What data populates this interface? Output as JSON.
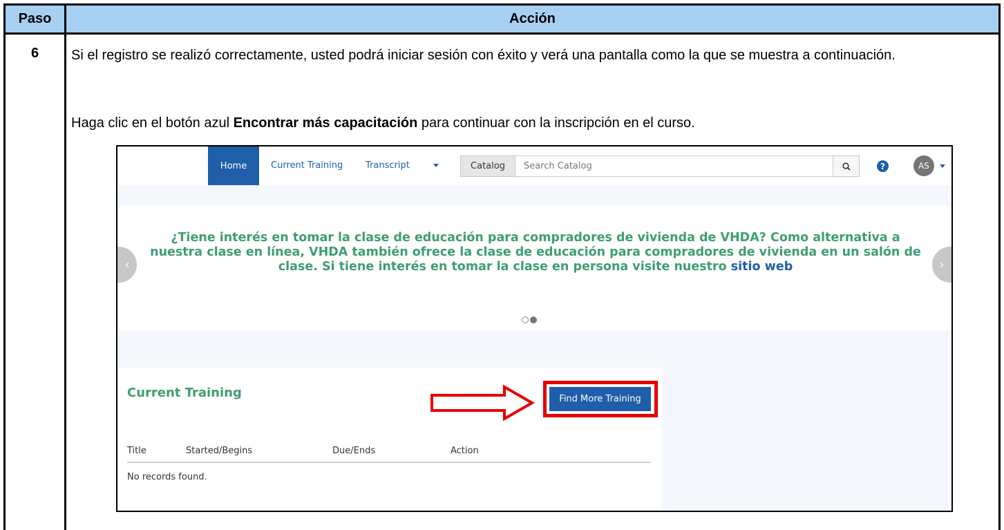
{
  "table": {
    "header_step": "Paso",
    "header_action": "Acción",
    "step_number": "6",
    "paragraph1": "Si el registro se realizó correctamente, usted podrá iniciar sesión con éxito y verá una pantalla como la que se muestra a continuación.",
    "paragraph2_before": "Haga clic en el botón azul ",
    "paragraph2_bold": "Encontrar más capacitación",
    "paragraph2_after": " para continuar con la inscripción en el curso."
  },
  "screenshot": {
    "nav": {
      "home": "Home",
      "current_training": "Current Training",
      "transcript": "Transcript",
      "catalog": "Catalog",
      "search_placeholder": "Search Catalog",
      "help": "?",
      "avatar_initials": "AS"
    },
    "banner": {
      "text": "¿Tiene interés en tomar la clase de educación para compradores de vivienda de VHDA? Como alternativa a nuestra clase en línea, VHDA también ofrece la clase de educación para compradores de vivienda en un salón de clase. Si tiene interés en tomar la clase en persona visite nuestro ",
      "link": "sitio web",
      "prev": "‹",
      "next": "›",
      "active_slide": 2,
      "total_slides": 2
    },
    "current_training": {
      "title": "Current Training",
      "find_button": "Find More Training",
      "columns": [
        "Title",
        "Started/Begins",
        "Due/Ends",
        "Action"
      ],
      "empty_message": "No records found."
    },
    "colors": {
      "header_bg": "#a6cff2",
      "nav_blue": "#1f5ea8",
      "green_text": "#3f9e70",
      "highlight_red": "#e60000"
    }
  }
}
